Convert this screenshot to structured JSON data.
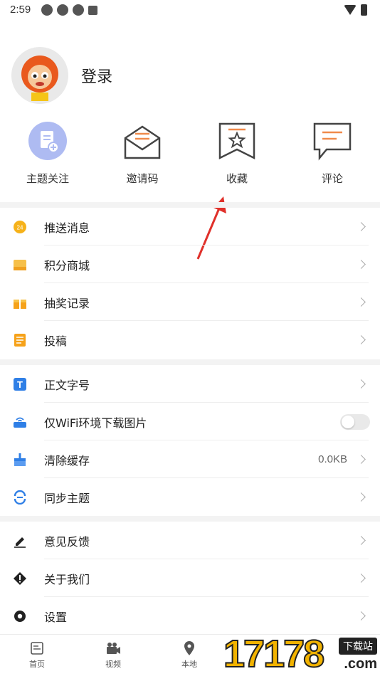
{
  "status_bar": {
    "time": "2:59"
  },
  "profile": {
    "login_label": "登录"
  },
  "quick_actions": [
    {
      "label": "主题关注",
      "icon": "topic-follow-icon"
    },
    {
      "label": "邀请码",
      "icon": "invite-envelope-icon"
    },
    {
      "label": "收藏",
      "icon": "favorite-bookmark-icon"
    },
    {
      "label": "评论",
      "icon": "comment-bubble-icon"
    }
  ],
  "menu_group_1": [
    {
      "label": "推送消息",
      "icon": "push-message-icon",
      "color": "#f6b21a"
    },
    {
      "label": "积分商城",
      "icon": "points-mall-icon",
      "color": "#f6b21a"
    },
    {
      "label": "抽奖记录",
      "icon": "gift-icon",
      "color": "#f6a21a"
    },
    {
      "label": "投稿",
      "icon": "submission-icon",
      "color": "#f6a21a"
    }
  ],
  "menu_group_2": [
    {
      "label": "正文字号",
      "icon": "font-size-icon",
      "color": "#2f7fe6"
    },
    {
      "label": "仅WiFi环境下载图片",
      "icon": "wifi-router-icon",
      "color": "#2f7fe6",
      "toggle": false
    },
    {
      "label": "清除缓存",
      "icon": "broom-icon",
      "color": "#2f7fe6",
      "value": "0.0KB"
    },
    {
      "label": "同步主题",
      "icon": "sync-icon",
      "color": "#2f7fe6"
    }
  ],
  "menu_group_3": [
    {
      "label": "意见反馈",
      "icon": "pencil-icon",
      "color": "#222"
    },
    {
      "label": "关于我们",
      "icon": "info-alert-icon",
      "color": "#222"
    },
    {
      "label": "设置",
      "icon": "gear-icon",
      "color": "#222"
    }
  ],
  "tab_bar": [
    {
      "label": "首页",
      "icon": "home-news-icon"
    },
    {
      "label": "视频",
      "icon": "video-camera-icon"
    },
    {
      "label": "本地",
      "icon": "location-pin-icon"
    }
  ],
  "watermark": {
    "number": "17178",
    "badge": "下载站",
    "suffix": ".com"
  }
}
